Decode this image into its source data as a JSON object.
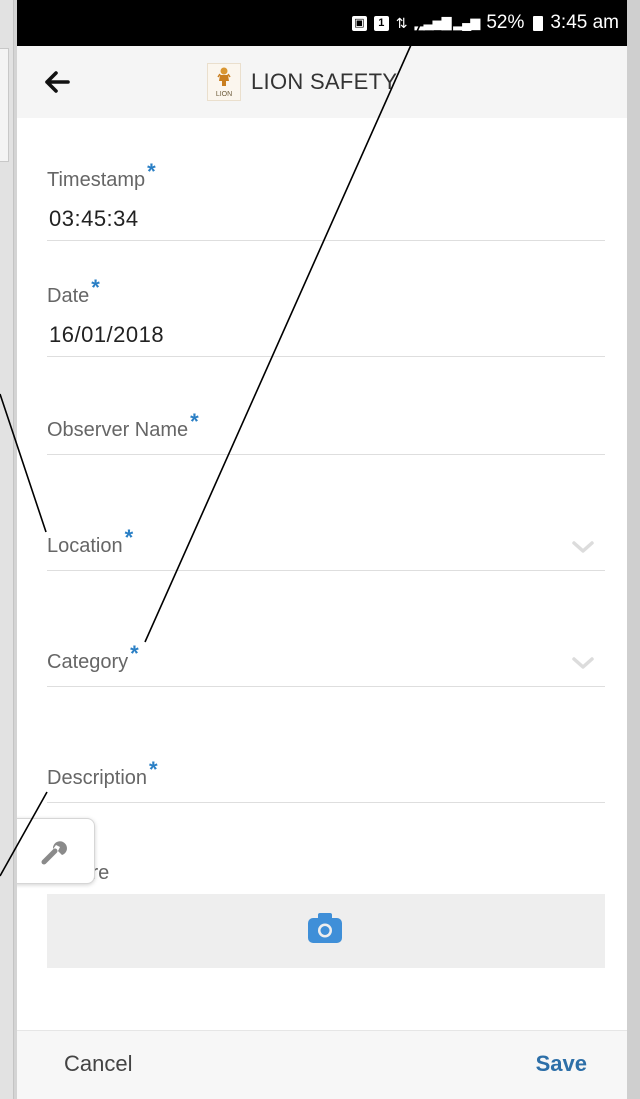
{
  "status_bar": {
    "sim_1": "1",
    "battery": "52%",
    "time": "3:45 am"
  },
  "app_bar": {
    "logo_text": "LION",
    "title": "LION SAFETY"
  },
  "form": {
    "timestamp": {
      "label": "Timestamp",
      "required_mark": "*",
      "value": "03:45:34"
    },
    "date": {
      "label": "Date",
      "required_mark": "*",
      "value": "16/01/2018"
    },
    "observer_name": {
      "label": "Observer Name",
      "required_mark": "*",
      "value": ""
    },
    "location": {
      "label": "Location",
      "required_mark": "*",
      "value": ""
    },
    "category": {
      "label": "Category",
      "required_mark": "*",
      "value": ""
    },
    "description": {
      "label": "Description",
      "required_mark": "*",
      "value": ""
    },
    "picture": {
      "label": "Picture"
    }
  },
  "actions": {
    "cancel_label": "Cancel",
    "save_label": "Save"
  },
  "icons": {
    "back": "arrow-left-icon",
    "dropdown": "chevron-down-icon",
    "camera": "camera-icon",
    "tools": "wrench-icon"
  },
  "colors": {
    "required_mark": "#2a7fc5",
    "save_text": "#2d6fa8",
    "camera_icon": "#3f8fd8"
  }
}
